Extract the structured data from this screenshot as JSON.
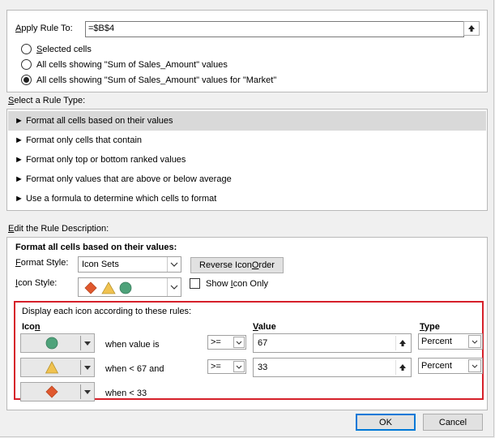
{
  "apply_rule": {
    "label_prefix": "A",
    "label_rest": "pply Rule To:",
    "value": "=$B$4",
    "options": [
      {
        "label_a": "S",
        "label_b": "elected cells"
      },
      {
        "label_a": "All cells showing \"Sum of Sales_Amount\" values",
        "label_b": ""
      },
      {
        "label_a": "All cells showin",
        "label_u": "g",
        "label_b": " \"Sum of Sales_Amount\" values for \"Market\""
      }
    ]
  },
  "rule_type": {
    "heading_a": "S",
    "heading_b": "elect a Rule Type:",
    "items": [
      "► Format all cells based on their values",
      "► Format only cells that contain",
      "► Format only top or bottom ranked values",
      "► Format only values that are above or below average",
      "► Use a formula to determine which cells to format"
    ]
  },
  "description": {
    "heading_a": "E",
    "heading_b": "dit the Rule Description:",
    "title": "Format all cells based on their values:",
    "format_style_label_a": "F",
    "format_style_label_b": "ormat Style:",
    "format_style_value": "Icon Sets",
    "reverse_button_a": "Reverse Icon ",
    "reverse_button_u": "O",
    "reverse_button_b": "rder",
    "icon_style_label_a": "I",
    "icon_style_label_b": "con Style:",
    "show_icon_only_a": "Show ",
    "show_icon_only_u": "I",
    "show_icon_only_b": "con Only",
    "rules_caption": "Display each icon according to these rules:",
    "col_icon_a": "Ico",
    "col_icon_u": "n",
    "col_value_a": "",
    "col_value_u": "V",
    "col_value_b": "alue",
    "col_type_a": "",
    "col_type_u": "T",
    "col_type_b": "ype",
    "rows": [
      {
        "icon": "green-circle-icon",
        "condition": "when value is",
        "operator": ">=",
        "value": "67",
        "type": "Percent"
      },
      {
        "icon": "yellow-triangle-icon",
        "condition": "when < 67 and",
        "operator": ">=",
        "value": "33",
        "type": "Percent"
      },
      {
        "icon": "red-diamond-icon",
        "condition": "when < 33"
      }
    ]
  },
  "footer": {
    "ok": "OK",
    "cancel": "Cancel"
  },
  "colors": {
    "green": "#4ea27a",
    "yellow": "#f0c250",
    "red": "#e0582e",
    "highlight": "#d6202a"
  }
}
